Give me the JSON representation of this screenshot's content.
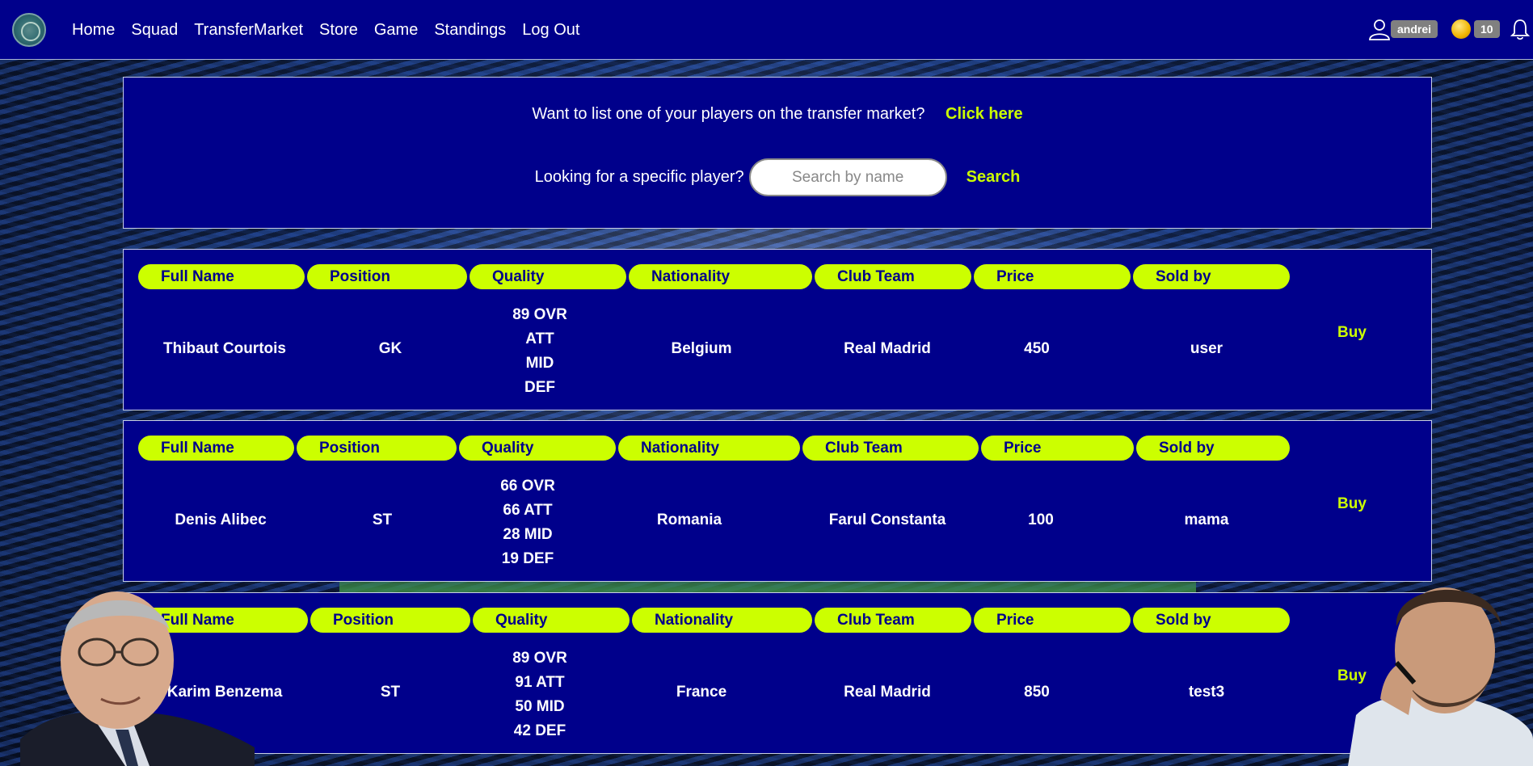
{
  "nav": {
    "links": [
      "Home",
      "Squad",
      "TransferMarket",
      "Store",
      "Game",
      "Standings",
      "Log Out"
    ],
    "username": "andrei",
    "coins": "10"
  },
  "listing": {
    "question": "Want to list one of your players on the transfer market?",
    "link": "Click here"
  },
  "search": {
    "question": "Looking for a specific player?",
    "placeholder": "Search by name",
    "button": "Search"
  },
  "headers": [
    "Full Name",
    "Position",
    "Quality",
    "Nationality",
    "Club Team",
    "Price",
    "Sold by"
  ],
  "buy_label": "Buy",
  "players": [
    {
      "name": "Thibaut Courtois",
      "position": "GK",
      "quality": [
        "89 OVR",
        "ATT",
        "MID",
        "DEF"
      ],
      "nationality": "Belgium",
      "club": "Real Madrid",
      "price": "450",
      "seller": "user"
    },
    {
      "name": "Denis Alibec",
      "position": "ST",
      "quality": [
        "66 OVR",
        "66 ATT",
        "28 MID",
        "19 DEF"
      ],
      "nationality": "Romania",
      "club": "Farul Constanta",
      "price": "100",
      "seller": "mama"
    },
    {
      "name": "Karim Benzema",
      "position": "ST",
      "quality": [
        "89 OVR",
        "91 ATT",
        "50 MID",
        "42 DEF"
      ],
      "nationality": "France",
      "club": "Real Madrid",
      "price": "850",
      "seller": "test3"
    }
  ]
}
